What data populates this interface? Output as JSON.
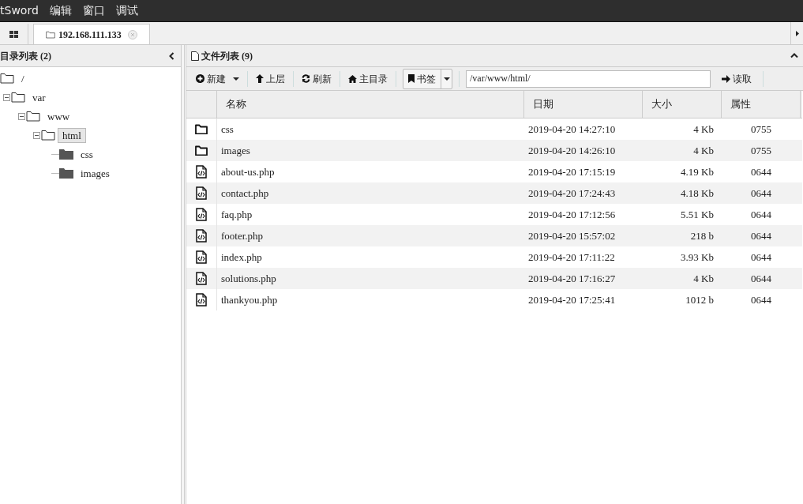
{
  "menu_bar": {
    "items": [
      "tSword",
      "编辑",
      "窗口",
      "调试"
    ]
  },
  "tab_bar": {
    "tabs": [
      {
        "label": "192.168.111.133",
        "selected": true
      }
    ]
  },
  "directory_panel": {
    "title": "目录列表 (2)",
    "tree": [
      {
        "label": "/",
        "kind": "open",
        "selected": false,
        "children": [
          {
            "label": "var",
            "kind": "open",
            "expanded": true,
            "selected": false,
            "children": [
              {
                "label": "www",
                "kind": "open",
                "expanded": true,
                "selected": false,
                "children": [
                  {
                    "label": "html",
                    "kind": "open",
                    "expanded": true,
                    "selected": true,
                    "children": [
                      {
                        "label": "css",
                        "kind": "closed",
                        "selected": false
                      },
                      {
                        "label": "images",
                        "kind": "closed",
                        "selected": false
                      }
                    ]
                  }
                ]
              }
            ]
          }
        ]
      }
    ]
  },
  "file_panel": {
    "title": "文件列表 (9)",
    "toolbar": {
      "new": "新建",
      "up": "上层",
      "refresh": "刷新",
      "home": "主目录",
      "bookmark": "书签",
      "path": "/var/www/html/",
      "read": "读取"
    },
    "table": {
      "columns": [
        "名称",
        "日期",
        "大小",
        "属性"
      ],
      "rows": [
        {
          "kind": "folder",
          "name": "css",
          "date": "2019-04-20 14:27:10",
          "size": "4 Kb",
          "attr": "0755"
        },
        {
          "kind": "folder",
          "name": "images",
          "date": "2019-04-20 14:26:10",
          "size": "4 Kb",
          "attr": "0755"
        },
        {
          "kind": "file",
          "name": "about-us.php",
          "date": "2019-04-20 17:15:19",
          "size": "4.19 Kb",
          "attr": "0644"
        },
        {
          "kind": "file",
          "name": "contact.php",
          "date": "2019-04-20 17:24:43",
          "size": "4.18 Kb",
          "attr": "0644"
        },
        {
          "kind": "file",
          "name": "faq.php",
          "date": "2019-04-20 17:12:56",
          "size": "5.51 Kb",
          "attr": "0644"
        },
        {
          "kind": "file",
          "name": "footer.php",
          "date": "2019-04-20 15:57:02",
          "size": "218 b",
          "attr": "0644"
        },
        {
          "kind": "file",
          "name": "index.php",
          "date": "2019-04-20 17:11:22",
          "size": "3.93 Kb",
          "attr": "0644"
        },
        {
          "kind": "file",
          "name": "solutions.php",
          "date": "2019-04-20 17:16:27",
          "size": "4 Kb",
          "attr": "0644"
        },
        {
          "kind": "file",
          "name": "thankyou.php",
          "date": "2019-04-20 17:25:41",
          "size": "1012 b",
          "attr": "0644"
        }
      ]
    }
  }
}
